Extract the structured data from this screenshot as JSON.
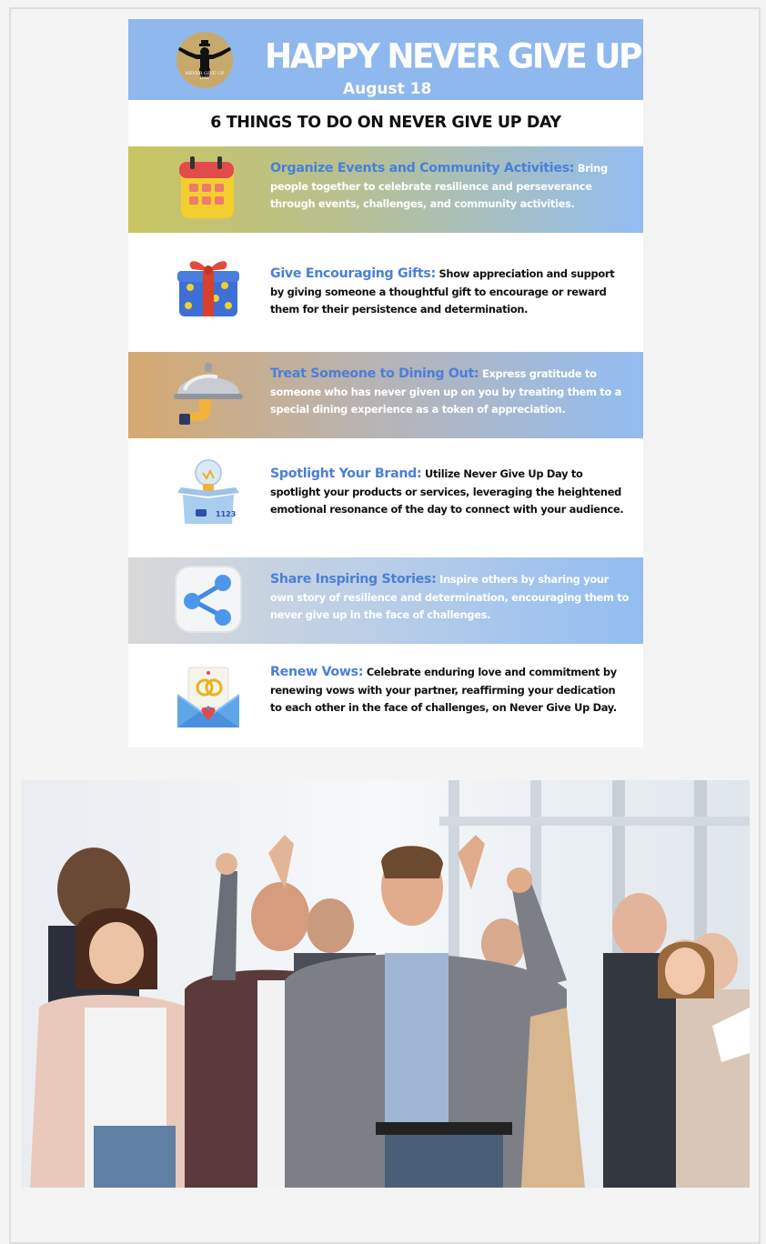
{
  "header": {
    "logo_text_line1": "NEVER GIVE UP",
    "logo_text_line2": "DAY",
    "title": "HAPPY NEVER GIVE UP DAY",
    "date": "August 18"
  },
  "subtitle": "6 THINGS TO DO ON NEVER GIVE UP DAY",
  "items": [
    {
      "title": "Organize Events and Community Activities:",
      "desc": " Bring people together to celebrate resilience and perseverance through events, challenges, and community activities.",
      "icon": "calendar-icon"
    },
    {
      "title": "Give Encouraging Gifts:",
      "desc": " Show appreciation and support by giving someone a thoughtful gift to encourage or reward them for their persistence and determination.",
      "icon": "gift-icon"
    },
    {
      "title": "Treat Someone to Dining Out:",
      "desc": " Express gratitude to someone who has never given up on you by treating them to a special dining experience as a token of appreciation.",
      "icon": "cloche-icon"
    },
    {
      "title": "Spotlight Your Brand:",
      "desc": " Utilize Never Give Up Day to spotlight your products or services, leveraging the heightened emotional resonance of the day to connect with your audience.",
      "icon": "lightbulb-box-icon"
    },
    {
      "title": "Share Inspiring Stories:",
      "desc": " Inspire others by sharing your own story of resilience and determination, encouraging them to never give up in the face of challenges.",
      "icon": "share-icon"
    },
    {
      "title": "Renew Vows:",
      "desc": " Celebrate enduring love and commitment by renewing vows with your partner, reaffirming your dedication to each other in the face of challenges, on Never Give Up Day.",
      "icon": "envelope-rings-icon"
    }
  ],
  "colors": {
    "header_bg": "#8fb8ee",
    "title_accent": "#4a7fd8",
    "band1_start": "#c9c561",
    "band3_start": "#d6a970",
    "band5_start": "#d8d8d8",
    "band_end": "#93bdf2"
  }
}
